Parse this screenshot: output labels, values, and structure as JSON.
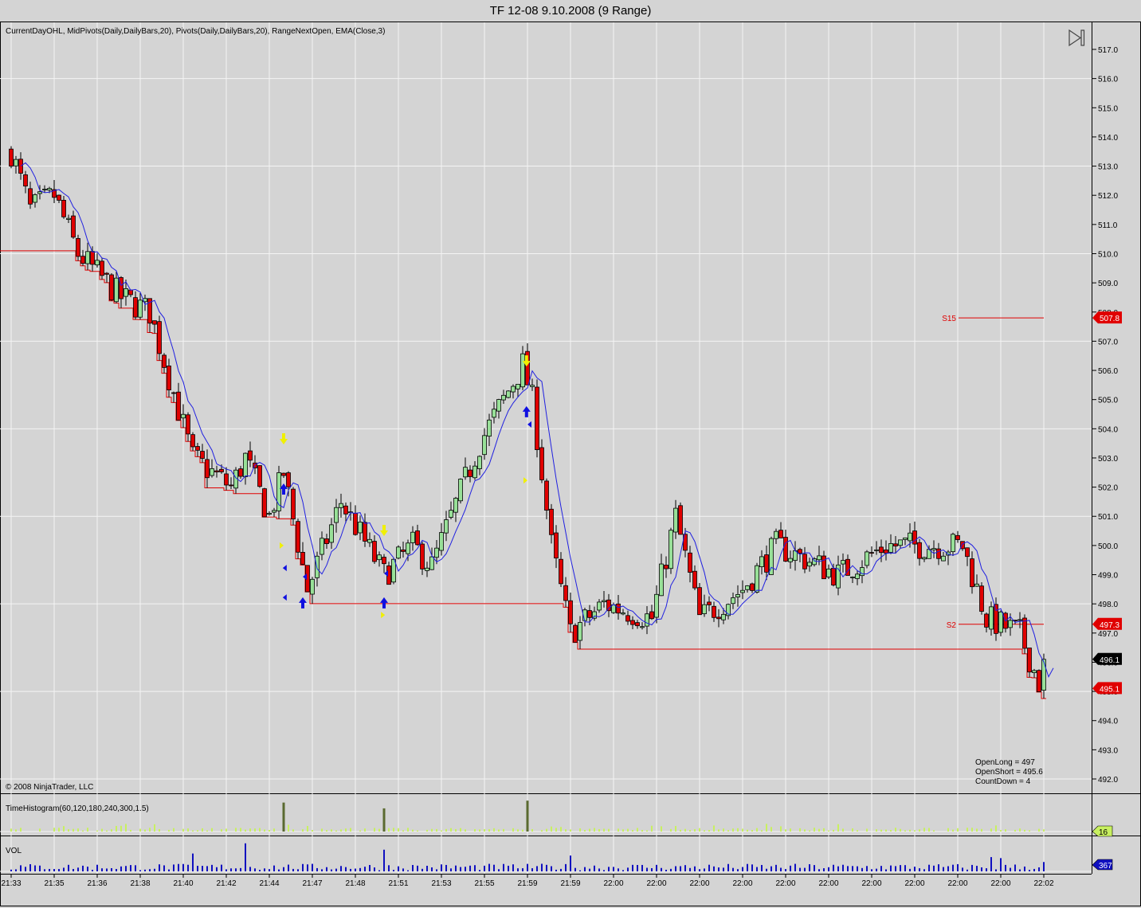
{
  "window_title": "TF 12-08  9.10.2008 (9 Range)",
  "indicators_label": "CurrentDayOHL,  MidPivots(Daily,DailyBars,20), Pivots(Daily,DailyBars,20),  RangeNextOpen, EMA(Close,3)",
  "copyright": "© 2008 NinjaTrader, LLC",
  "info_box": [
    "OpenLong = 497",
    "OpenShort = 495.6",
    "CountDown = 4"
  ],
  "time_histogram_label": "TimeHistogram(60,120,180,240,300,1.5)",
  "volume_label": "VOL",
  "colors": {
    "up": "#98e098",
    "down": "#e00000",
    "ema": "#2020e0",
    "support": "#e00000",
    "grid": "#f4f4f4",
    "bg": "#d4d4d4",
    "hist": "#c8f060",
    "hist_big": "#5a6a30",
    "vol": "#1010c0"
  },
  "chart_data": {
    "type": "candlestick",
    "title": "TF 12-08  9.10.2008 (9 Range)",
    "y_range": [
      491.5,
      517.5
    ],
    "y_ticks": [
      "517.0",
      "516.0",
      "515.0",
      "514.0",
      "513.0",
      "512.0",
      "511.0",
      "510.0",
      "509.0",
      "508.0",
      "507.0",
      "506.0",
      "505.0",
      "504.0",
      "503.0",
      "502.0",
      "501.0",
      "500.0",
      "499.0",
      "498.0",
      "497.0",
      "496.0",
      "495.0",
      "494.0",
      "493.0",
      "492.0"
    ],
    "x_ticks": [
      "21:33",
      "21:35",
      "21:36",
      "21:38",
      "21:40",
      "21:42",
      "21:44",
      "21:47",
      "21:48",
      "21:51",
      "21:53",
      "21:55",
      "21:59",
      "21:59",
      "22:00",
      "22:00",
      "22:00",
      "22:00",
      "22:00",
      "22:00",
      "22:00",
      "22:00",
      "22:00",
      "22:00",
      "22:02"
    ],
    "bar_count": 217,
    "bars_per_x_tick": 9,
    "price_path_keypoints": [
      [
        0,
        513.5
      ],
      [
        4,
        511.5
      ],
      [
        9,
        512
      ],
      [
        14,
        510
      ],
      [
        23,
        508.5
      ],
      [
        29,
        508
      ],
      [
        38,
        503
      ],
      [
        46,
        502
      ],
      [
        49,
        503
      ],
      [
        54,
        501
      ],
      [
        57,
        502.5
      ],
      [
        62,
        498.5
      ],
      [
        69,
        501.5
      ],
      [
        78,
        499
      ],
      [
        84,
        500
      ],
      [
        88,
        499.3
      ],
      [
        98,
        503.5
      ],
      [
        107,
        506.2
      ],
      [
        109,
        505
      ],
      [
        113,
        500
      ],
      [
        117,
        497
      ],
      [
        124,
        498
      ],
      [
        134,
        497.5
      ],
      [
        139,
        501
      ],
      [
        144,
        497.5
      ],
      [
        153,
        498.5
      ],
      [
        160,
        500
      ],
      [
        173,
        499
      ],
      [
        183,
        500
      ],
      [
        193,
        500
      ],
      [
        199,
        500
      ],
      [
        204,
        497.5
      ],
      [
        211,
        497
      ],
      [
        215,
        495.3
      ],
      [
        216,
        496.1
      ]
    ],
    "ema_period": 3,
    "day_low_start": 510.1,
    "pivot_lines": [
      {
        "label": "S15",
        "price": 507.8,
        "tag": "507.8"
      },
      {
        "label": "S2",
        "price": 497.3,
        "tag": "497.3"
      }
    ],
    "price_tags": [
      {
        "price": 496.1,
        "tag": "496.1",
        "color": "#000000"
      },
      {
        "price": 495.1,
        "tag": "495.1",
        "color": "#e00000"
      }
    ],
    "signals": [
      {
        "kind": "down-arrow",
        "color": "#f0f000",
        "bar": 57,
        "price": 503.6
      },
      {
        "kind": "down-arrow",
        "color": "#f0f000",
        "bar": 78,
        "price": 500.46
      },
      {
        "kind": "down-arrow",
        "color": "#f0f000",
        "bar": 107.8,
        "price": 506.27
      },
      {
        "kind": "up-arrow",
        "color": "#1010e0",
        "bar": 57,
        "price": 501.99
      },
      {
        "kind": "up-arrow",
        "color": "#1010e0",
        "bar": 61,
        "price": 498.09
      },
      {
        "kind": "up-arrow",
        "color": "#1010e0",
        "bar": 78,
        "price": 498.09
      },
      {
        "kind": "up-arrow",
        "color": "#1010e0",
        "bar": 107.8,
        "price": 504.64
      },
      {
        "kind": "left-tri",
        "color": "#1010e0",
        "bar": 57.3,
        "price": 499.23
      },
      {
        "kind": "left-tri",
        "color": "#1010e0",
        "bar": 57.3,
        "price": 498.22
      },
      {
        "kind": "left-tri",
        "color": "#1010e0",
        "bar": 61.5,
        "price": 498.93
      },
      {
        "kind": "left-tri",
        "color": "#1010e0",
        "bar": 78.5,
        "price": 499.04
      },
      {
        "kind": "left-tri",
        "color": "#1010e0",
        "bar": 108.5,
        "price": 504.15
      },
      {
        "kind": "right-tri",
        "color": "#f0f000",
        "bar": 56.5,
        "price": 500.0
      },
      {
        "kind": "right-tri",
        "color": "#f0f000",
        "bar": 77.7,
        "price": 497.62
      },
      {
        "kind": "right-tri",
        "color": "#f0f000",
        "bar": 107.5,
        "price": 502.23
      }
    ],
    "time_histogram": {
      "last_value": 16,
      "last_tag": "16",
      "spikes": [
        {
          "bar": 57,
          "value": 300
        },
        {
          "bar": 78,
          "value": 240
        },
        {
          "bar": 107.8,
          "value": 320
        }
      ],
      "max": 330
    },
    "volume": {
      "last_value": 367,
      "last_tag": "367",
      "spikes": [
        {
          "bar": 49,
          "value": 1100
        },
        {
          "bar": 38,
          "value": 700
        },
        {
          "bar": 78,
          "value": 850
        },
        {
          "bar": 117,
          "value": 620
        },
        {
          "bar": 205,
          "value": 560
        },
        {
          "bar": 207,
          "value": 520
        }
      ],
      "max": 1250
    }
  }
}
